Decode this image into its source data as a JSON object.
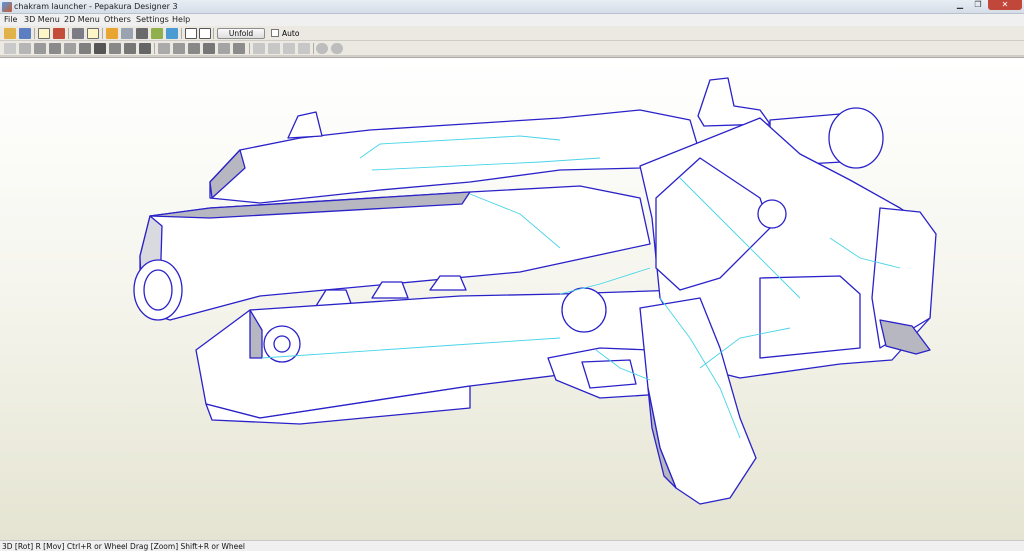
{
  "window": {
    "title": "chakram launcher - Pepakura Designer 3",
    "minimize": "▁",
    "maximize": "❐",
    "close": "✕"
  },
  "menu": [
    "File",
    "3D Menu",
    "2D Menu",
    "Others",
    "Settings",
    "Help"
  ],
  "toolbar": {
    "unfold_label": "Unfold",
    "auto_label": "Auto",
    "row1_icons": [
      "open-icon",
      "save-icon",
      "select-icon",
      "texture-icon",
      "cube-icon",
      "shaded-icon",
      "edge-icon",
      "pencil-icon",
      "cylinder-icon",
      "move-icon",
      "light-icon",
      "view-icon",
      "single-window-icon",
      "dual-window-icon"
    ],
    "row2_icons": [
      "print-icon",
      "join-icon",
      "flaps-icon",
      "edit-icon",
      "grid-icon",
      "parts-icon",
      "rotate-icon",
      "split-icon",
      "select-face-icon",
      "edge-id-icon",
      "flip-icon",
      "delete-icon",
      "layout-icon",
      "align-left-icon",
      "align-center-icon",
      "align-right-icon",
      "align-top-icon",
      "align-middle-icon",
      "align-bottom-icon",
      "zoom-in-icon",
      "zoom-out-icon"
    ]
  },
  "colors": {
    "model_fill": "#ffffff",
    "model_shade": "#b7b7c1",
    "edge_outline": "#2a22c8",
    "edge_fold": "#48d4e8"
  },
  "status": {
    "text": "3D [Rot] R [Mov] Ctrl+R or Wheel Drag [Zoom] Shift+R or Wheel"
  }
}
